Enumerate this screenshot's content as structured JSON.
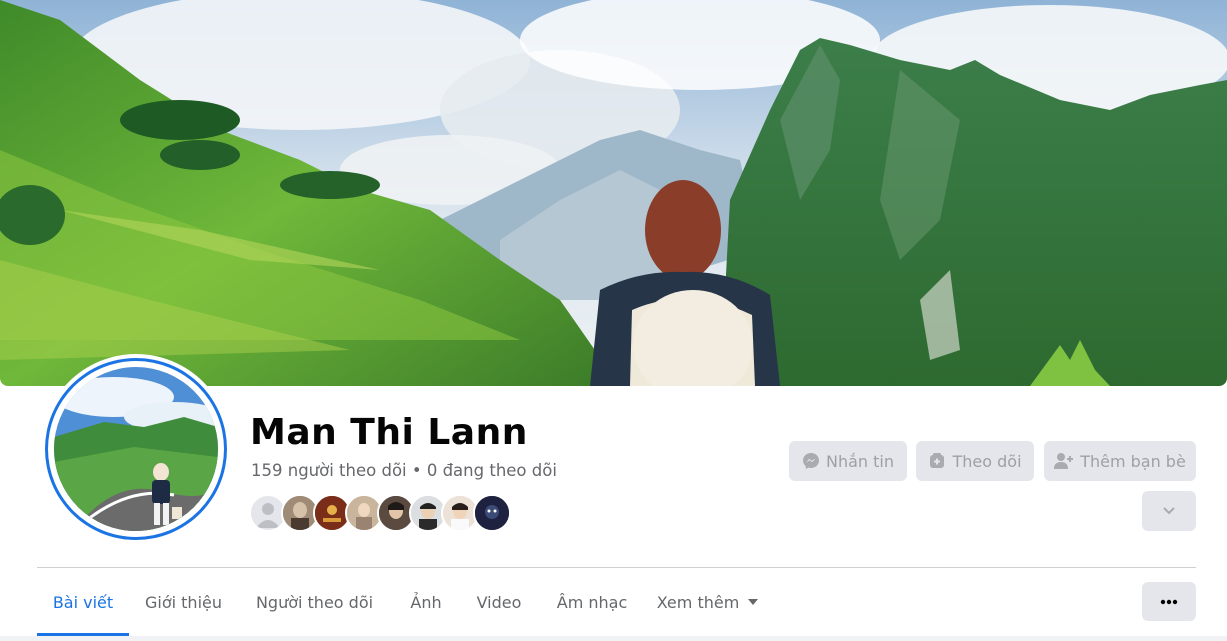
{
  "profile": {
    "name": "Man Thi Lann",
    "follow_stats": "159 người theo dõi • 0 đang theo dõi"
  },
  "actions": {
    "message": "Nhắn tin",
    "follow": "Theo dõi",
    "add_friend": "Thêm bạn bè"
  },
  "tabs": [
    {
      "label": "Bài viết",
      "active": true
    },
    {
      "label": "Giới thiệu"
    },
    {
      "label": "Người theo dõi"
    },
    {
      "label": "Ảnh"
    },
    {
      "label": "Video"
    },
    {
      "label": "Âm nhạc"
    },
    {
      "label": "Xem thêm"
    }
  ],
  "colors": {
    "accent": "#1b74e4",
    "button_bg": "#e4e6eb",
    "muted_text": "#65676b"
  },
  "friend_avatars": [
    "default-avatar",
    "avatar-1",
    "avatar-2",
    "avatar-3",
    "avatar-4",
    "avatar-5",
    "avatar-6",
    "avatar-7"
  ]
}
